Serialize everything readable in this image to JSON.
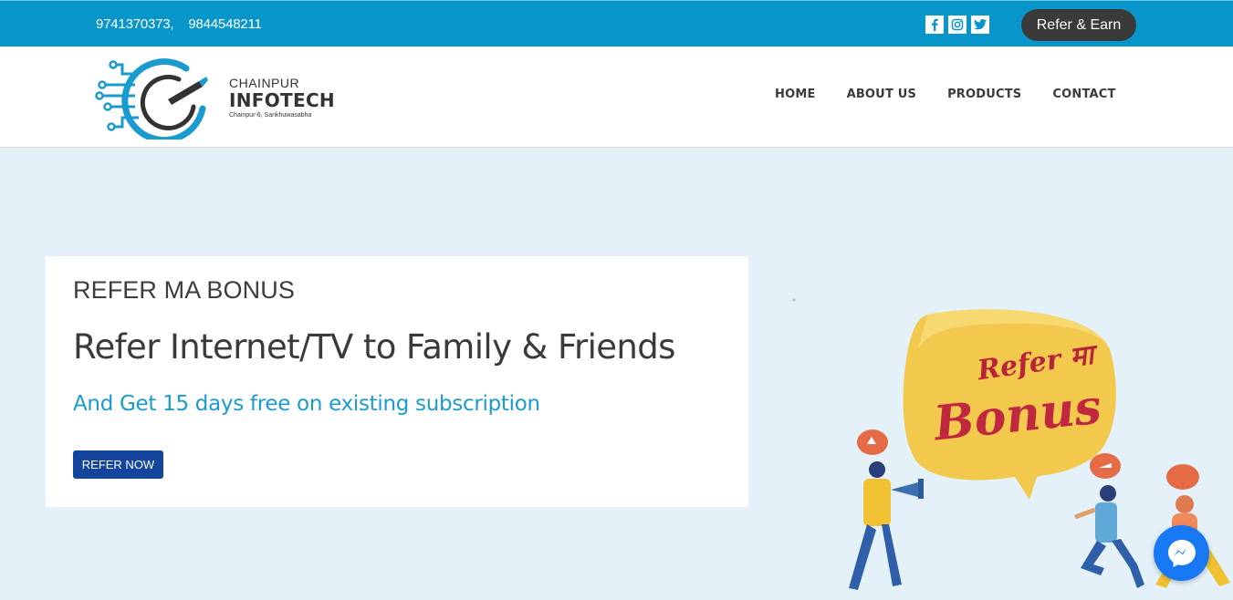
{
  "topbar": {
    "phone1": "9741370373,",
    "phone2": "9844548211",
    "social_icons": [
      "facebook-icon",
      "instagram-icon",
      "twitter-icon"
    ],
    "refer_earn_label": "Refer & Earn"
  },
  "brand": {
    "line1": "CHAINPUR",
    "line2": "INFOTECH",
    "address": "Chainpur-6, Sankhuwasabha"
  },
  "nav": {
    "items": [
      {
        "label": "HOME"
      },
      {
        "label": "ABOUT US"
      },
      {
        "label": "PRODUCTS"
      },
      {
        "label": "CONTACT"
      }
    ]
  },
  "hero": {
    "kicker": "REFER MA BONUS",
    "headline": "Refer Internet/TV to Family & Friends",
    "subheadline": "And Get 15 days free on existing subscription",
    "cta_label": "REFER NOW",
    "illustration_text_1": "Refer मा",
    "illustration_text_2": "Bonus"
  },
  "colors": {
    "topbar": "#0895c9",
    "hero_bg": "#e5f1f9",
    "accent_blue": "#1a9bd0",
    "button_blue": "#14459c",
    "dark_pill": "#3a3a3a"
  },
  "chat": {
    "icon": "messenger-icon"
  }
}
